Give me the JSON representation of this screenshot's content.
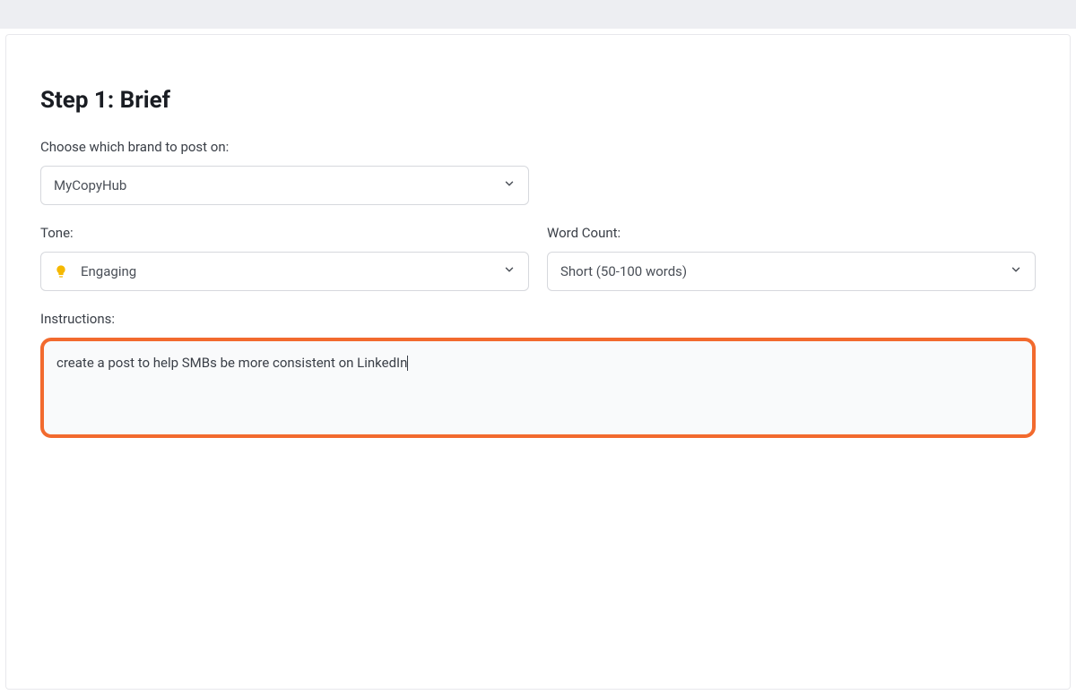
{
  "header": {
    "step_title": "Step 1: Brief"
  },
  "brand": {
    "label": "Choose which brand to post on:",
    "selected": "MyCopyHub"
  },
  "tone": {
    "label": "Tone:",
    "selected": "Engaging",
    "icon": "bulb-icon"
  },
  "wordcount": {
    "label": "Word Count:",
    "selected": "Short (50-100 words)"
  },
  "instructions": {
    "label": "Instructions:",
    "value": "create a post to help SMBs be more consistent on LinkedIn"
  },
  "colors": {
    "highlight_border": "#f26a2e",
    "bulb": "#f5b800"
  }
}
